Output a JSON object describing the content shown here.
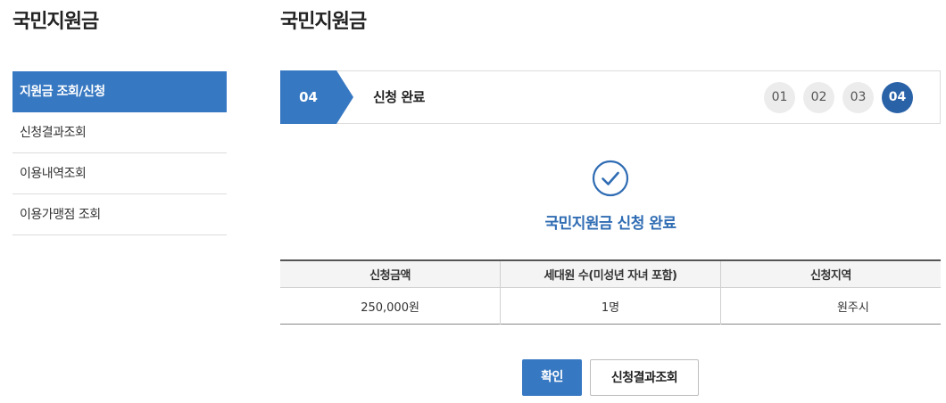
{
  "sidebar": {
    "title": "국민지원금",
    "items": [
      {
        "label": "지원금 조회/신청",
        "active": true
      },
      {
        "label": "신청결과조회",
        "active": false
      },
      {
        "label": "이용내역조회",
        "active": false
      },
      {
        "label": "이용가맹점 조회",
        "active": false
      }
    ]
  },
  "main": {
    "title": "국민지원금",
    "step": {
      "current": "04",
      "title": "신청 완료",
      "indicators": [
        "01",
        "02",
        "03",
        "04"
      ]
    },
    "completion_icon": "check-circle-icon",
    "completion_message": "국민지원금 신청 완료",
    "table": {
      "headers": [
        "신청금액",
        "세대원 수(미성년 자녀 포함)",
        "신청지역"
      ],
      "rows": [
        [
          "250,000원",
          "1명",
          "원주시"
        ]
      ]
    },
    "buttons": {
      "confirm": "확인",
      "check_result": "신청결과조회"
    }
  },
  "colors": {
    "primary": "#3778c2",
    "step_current": "#2a62a8",
    "message": "#2f6cb3"
  }
}
